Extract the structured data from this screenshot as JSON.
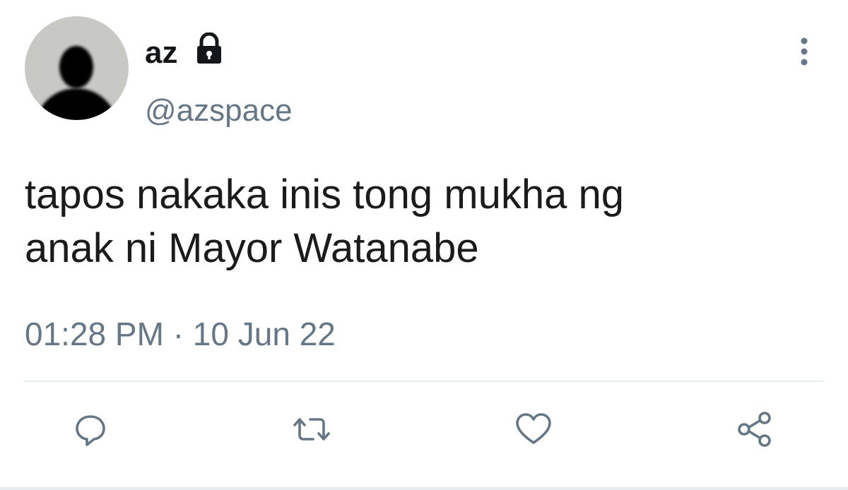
{
  "tweet": {
    "author": {
      "display_name": "az",
      "handle": "@azspace",
      "protected_icon": "lock-icon"
    },
    "text_line1": "tapos nakaka inis tong mukha ng",
    "text_line2": "anak ni Mayor Watanabe",
    "time": "01:28 PM",
    "separator": "·",
    "date": "10 Jun 22"
  },
  "actions": {
    "reply_icon": "comment-icon",
    "retweet_icon": "retweet-icon",
    "like_icon": "heart-icon",
    "share_icon": "share-icon",
    "more_icon": "more-vertical-icon"
  },
  "colors": {
    "text": "#1b1b1b",
    "secondary": "#657786",
    "divider": "#e6ecf0"
  }
}
